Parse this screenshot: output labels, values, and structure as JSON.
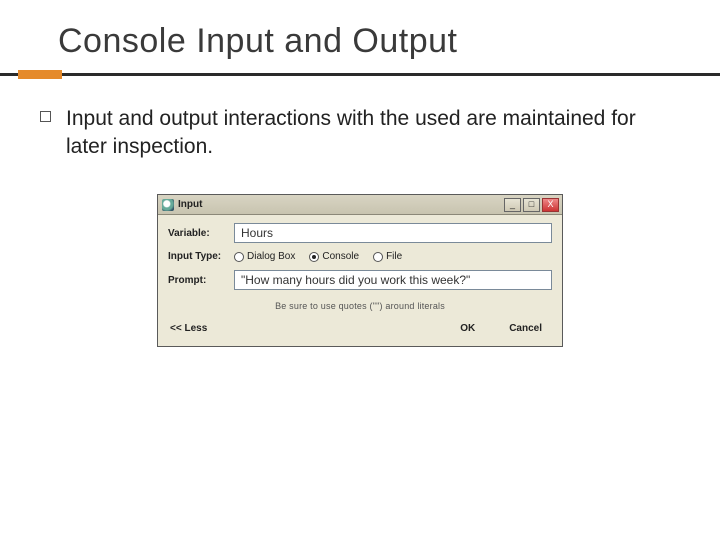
{
  "slide": {
    "title": "Console Input and Output",
    "bullet": "Input and output interactions with the used are maintained for later inspection."
  },
  "dialog": {
    "title": "Input",
    "fields": {
      "variable_label": "Variable:",
      "variable_value": "Hours",
      "input_type_label": "Input Type:",
      "options": {
        "dialog_box": "Dialog Box",
        "console": "Console",
        "file": "File"
      },
      "selected_option": "console",
      "prompt_label": "Prompt:",
      "prompt_value": "\"How many hours did you work this week?\"",
      "hint": "Be sure to use quotes (\"\") around literals"
    },
    "buttons": {
      "less": "<< Less",
      "ok": "OK",
      "cancel": "Cancel"
    },
    "window_controls": {
      "min": "_",
      "max": "□",
      "close": "X"
    }
  }
}
